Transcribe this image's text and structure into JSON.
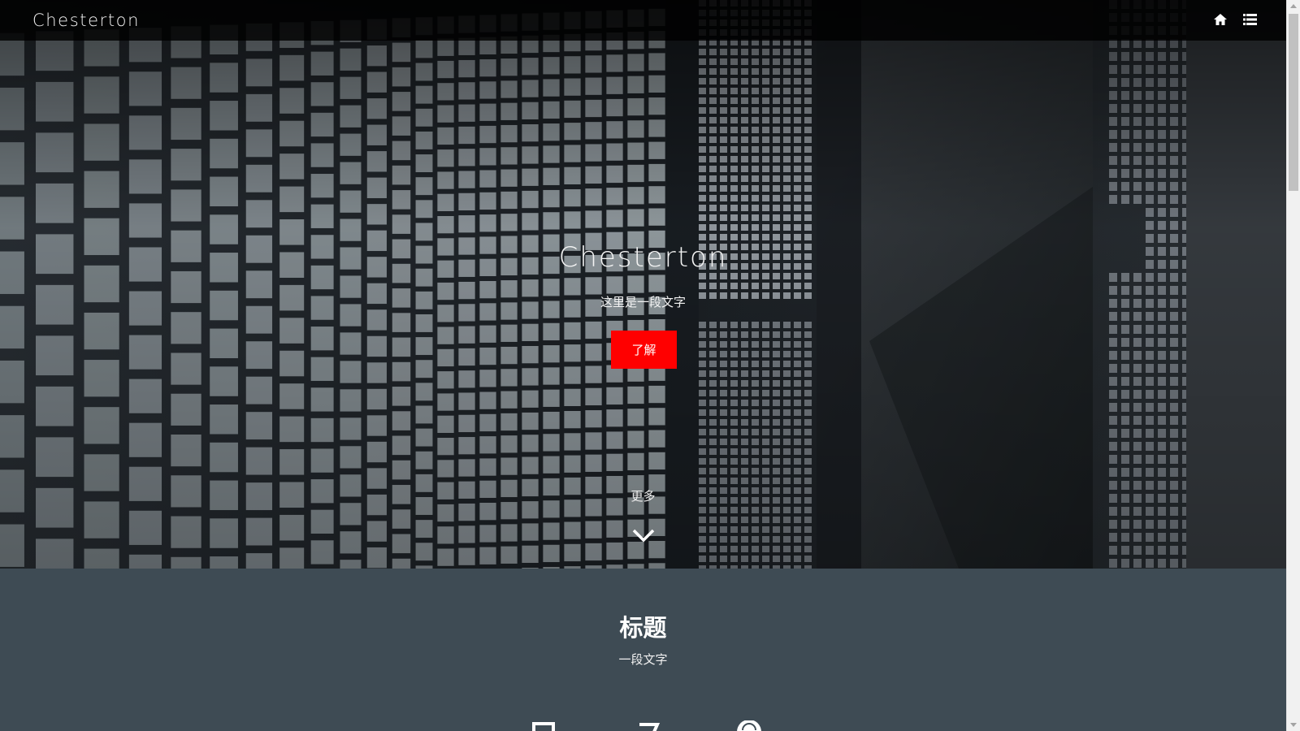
{
  "navbar": {
    "brand": "Chesterton",
    "icons": [
      "home-icon",
      "list-icon"
    ]
  },
  "hero": {
    "title": "Chesterton",
    "subtitle": "这里是一段文字",
    "button_label": "了解",
    "more_label": "更多",
    "more_icon": "chevron-down-icon"
  },
  "section": {
    "title": "标题",
    "text": "一段文字",
    "feature_icons": [
      "feature-icon-1",
      "feature-icon-2",
      "feature-icon-3"
    ]
  },
  "colors": {
    "accent": "#ff0000",
    "navbar_bg": "#000000",
    "section_bg": "#3e4b54",
    "text": "#ffffff"
  }
}
